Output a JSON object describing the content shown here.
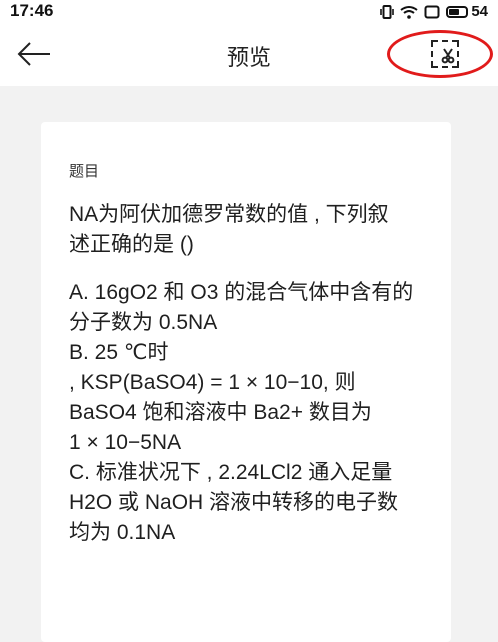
{
  "status": {
    "time": "17:46",
    "battery": "54",
    "icons": [
      "vibrate-icon",
      "wifi-icon",
      "screen-icon",
      "battery-icon"
    ]
  },
  "header": {
    "title": "预览",
    "back_icon": "back-arrow-icon",
    "action_icon": "crop-scissors-icon",
    "highlight_color": "#e11b1b"
  },
  "question": {
    "heading": "题目",
    "stem_line1": "NA为阿伏加德罗常数的值 , 下列叙",
    "stem_line2": "述正确的是 ()",
    "options": [
      "A. 16gO2 和 O3 的混合气体中含有的",
      "分子数为 0.5NA",
      "B.  25 ℃时",
      ", KSP(BaSO4) = 1 × 10−10, 则",
      "BaSO4 饱和溶液中 Ba2+ 数目为",
      "1 × 10−5NA",
      "C. 标准状况下 , 2.24LCl2 通入足量",
      "H2O 或 NaOH 溶液中转移的电子数",
      "均为 0.1NA"
    ]
  }
}
